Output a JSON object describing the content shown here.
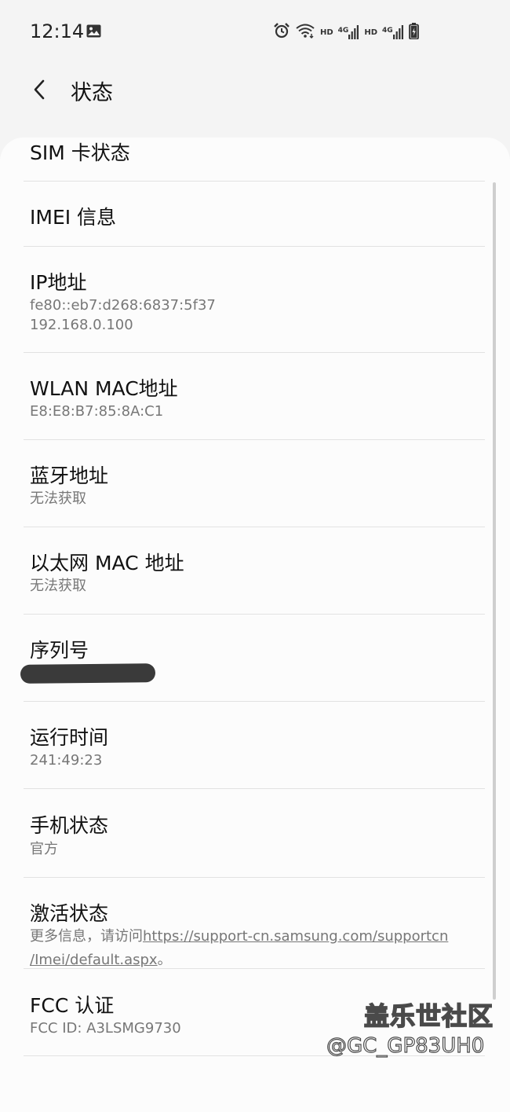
{
  "status_bar": {
    "time": "12:14",
    "network_hd_1": "HD",
    "network_4g_1": "4G",
    "network_hd_2": "HD",
    "network_4g_2": "4G"
  },
  "header": {
    "title": "状态"
  },
  "items": [
    {
      "title": "SIM 卡状态"
    },
    {
      "title": "IMEI 信息"
    },
    {
      "title": "IP地址",
      "lines": [
        "fe80::eb7:d268:6837:5f37",
        "192.168.0.100"
      ]
    },
    {
      "title": "WLAN MAC地址",
      "lines": [
        "E8:E8:B7:85:8A:C1"
      ]
    },
    {
      "title": "蓝牙地址",
      "lines": [
        "无法获取"
      ]
    },
    {
      "title": "以太网 MAC 地址",
      "lines": [
        "无法获取"
      ]
    },
    {
      "title": "序列号"
    },
    {
      "title": "运行时间",
      "lines": [
        "241:49:23"
      ]
    },
    {
      "title": "手机状态",
      "lines": [
        "官方"
      ]
    },
    {
      "title": "激活状态",
      "prefix": "更多信息，请访问",
      "link_line1": "https://support-cn.samsung.com/supportcn",
      "link_line2": "/Imei/default.aspx",
      "suffix": "。"
    },
    {
      "title": "FCC 认证",
      "lines": [
        "FCC ID: A3LSMG9730"
      ]
    }
  ],
  "watermark": {
    "title": "盖乐世社区",
    "handle": "@GC_GP83UH0"
  }
}
